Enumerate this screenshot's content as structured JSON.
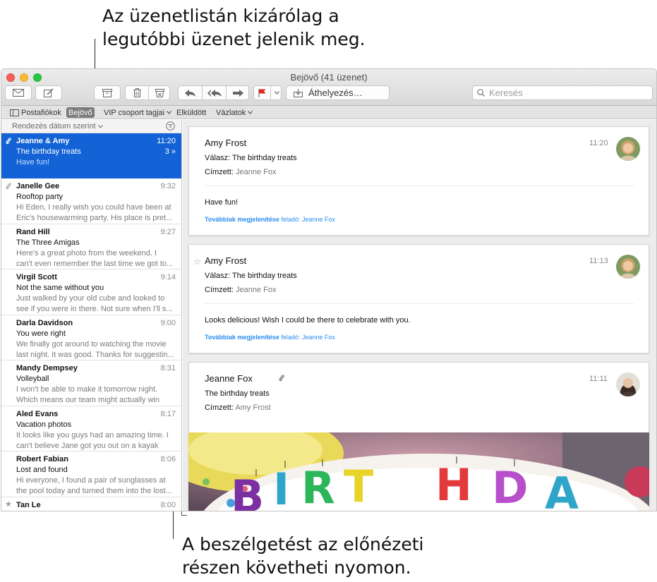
{
  "callouts": {
    "top_line1": "Az üzenetlistán kizárólag a",
    "top_line2": "legutóbbi üzenet jelenik meg.",
    "bottom_line1": "A beszélgetést az előnézeti",
    "bottom_line2": "részen követheti nyomon."
  },
  "window": {
    "title": "Bejövő (41 üzenet)"
  },
  "toolbar": {
    "move_label": "Áthelyezés…",
    "search_placeholder": "Keresés"
  },
  "favorites": {
    "mailboxes": "Postafiókok",
    "inbox": "Bejövő",
    "vip": "VIP csoport tagjai",
    "sent": "Elküldött",
    "drafts": "Vázlatok"
  },
  "list": {
    "sort_label": "Rendezés dátum szerint",
    "messages": [
      {
        "sender": "Jeanne & Amy",
        "time": "11:20",
        "subject": "The birthday treats",
        "count": "3 »",
        "preview1": "Have fun!",
        "preview2": ""
      },
      {
        "sender": "Janelle Gee",
        "time": "9:32",
        "subject": "Rooftop party",
        "preview1": "Hi Eden, I really wish you could have been at",
        "preview2": "Eric's housewarming party. His place is pret..."
      },
      {
        "sender": "Rand Hill",
        "time": "9:27",
        "subject": "The Three Amigas",
        "preview1": "Here's a great photo from the weekend. I",
        "preview2": "can't even remember the last time we got to..."
      },
      {
        "sender": "Virgil Scott",
        "time": "9:14",
        "subject": "Not the same without you",
        "preview1": "Just walked by your old cube and looked to",
        "preview2": "see if you were in there. Not sure when I'll s..."
      },
      {
        "sender": "Darla Davidson",
        "time": "9:00",
        "subject": "You were right",
        "preview1": "We finally got around to watching the movie",
        "preview2": "last night. It was good. Thanks for suggestin..."
      },
      {
        "sender": "Mandy Dempsey",
        "time": "8:31",
        "subject": "Volleyball",
        "preview1": "I won't be able to make it tomorrow night.",
        "preview2": "Which means our team might actually win"
      },
      {
        "sender": "Aled Evans",
        "time": "8:17",
        "subject": "Vacation photos",
        "preview1": "It looks like you guys had an amazing time. I",
        "preview2": "can't believe Jane got you out on a kayak"
      },
      {
        "sender": "Robert Fabian",
        "time": "8:06",
        "subject": "Lost and found",
        "preview1": "Hi everyone, I found a pair of sunglasses at",
        "preview2": "the pool today and turned them into the lost..."
      },
      {
        "sender": "Tan Le",
        "time": "8:00",
        "subject": "",
        "preview1": "",
        "preview2": ""
      }
    ]
  },
  "conversation": [
    {
      "sender": "Amy Frost",
      "time": "11:20",
      "reply_label": "Válasz:",
      "subject": "The birthday treats",
      "to_label": "Címzett:",
      "to": "Jeanne Fox",
      "body": "Have fun!",
      "more_bold": "Továbbiak megjelenítése",
      "more_rest": " feladó: Jeanne Fox"
    },
    {
      "sender": "Amy Frost",
      "time": "11:13",
      "reply_label": "Válasz:",
      "subject": "The birthday treats",
      "to_label": "Címzett:",
      "to": "Jeanne Fox",
      "body": "Looks delicious! Wish I could be there to celebrate with you.",
      "more_bold": "Továbbiak megjelenítése",
      "more_rest": " feladó: Jeanne Fox"
    },
    {
      "sender": "Jeanne Fox",
      "time": "11:11",
      "subject": "The birthday treats",
      "to_label": "Címzett:",
      "to": "Amy Frost"
    }
  ],
  "photo_letters": [
    "B",
    "I",
    "R",
    "T",
    "H",
    "D",
    "A"
  ],
  "colors": {
    "selection": "#1463d6",
    "link": "#2a8cf0",
    "flag": "#e0261f"
  },
  "icons": [
    "compose-icon",
    "new-message-icon",
    "archive-icon",
    "trash-icon",
    "junk-icon",
    "reply-icon",
    "reply-all-icon",
    "forward-icon",
    "flag-icon",
    "move-icon",
    "search-icon",
    "attachment-icon",
    "star-icon",
    "filter-icon"
  ]
}
